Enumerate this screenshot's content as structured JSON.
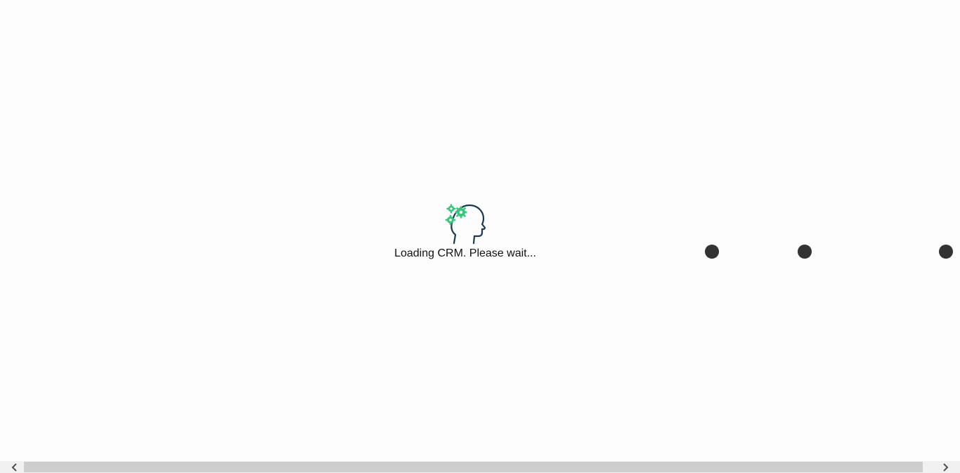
{
  "loader": {
    "icon": "head-with-gears-icon",
    "message": "Loading CRM. Please wait..."
  },
  "progress_dots": {
    "count": 3,
    "color": "#333333"
  },
  "colors": {
    "background": "#fdfdfd",
    "gear_accent": "#3dc47e",
    "head_outline": "#1b3a52"
  },
  "scrollbar": {
    "left_arrow_icon": "chevron-left-icon",
    "right_arrow_icon": "chevron-right-icon"
  }
}
